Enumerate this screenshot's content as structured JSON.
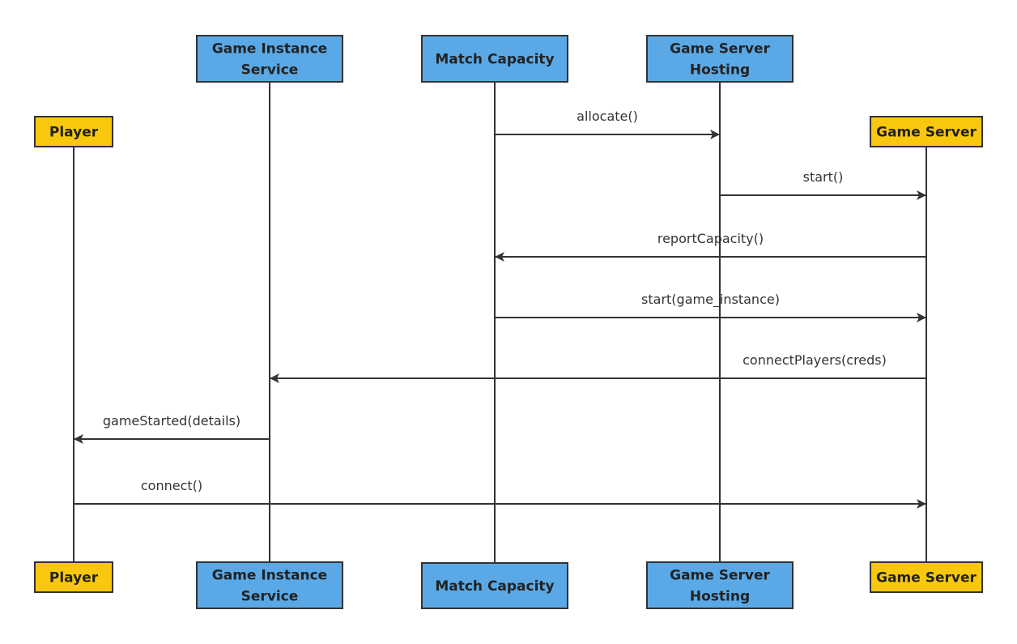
{
  "colors": {
    "service": "#5aa9e6",
    "actor": "#f9c80e",
    "line": "#333333"
  },
  "participants": [
    {
      "id": "player",
      "lines": [
        "Player"
      ],
      "kind": "actor"
    },
    {
      "id": "gis",
      "lines": [
        "Game Instance",
        "Service"
      ],
      "kind": "service"
    },
    {
      "id": "mc",
      "lines": [
        "Match Capacity"
      ],
      "kind": "service"
    },
    {
      "id": "gsh",
      "lines": [
        "Game Server",
        "Hosting"
      ],
      "kind": "service"
    },
    {
      "id": "gs",
      "lines": [
        "Game Server"
      ],
      "kind": "actor"
    }
  ],
  "messages": [
    {
      "from": "mc",
      "to": "gsh",
      "label": "allocate()"
    },
    {
      "from": "gsh",
      "to": "gs",
      "label": "start()"
    },
    {
      "from": "gs",
      "to": "mc",
      "label": "reportCapacity()"
    },
    {
      "from": "mc",
      "to": "gs",
      "label": "start(game_instance)"
    },
    {
      "from": "gs",
      "to": "gis",
      "label": "connectPlayers(creds)"
    },
    {
      "from": "gis",
      "to": "player",
      "label": "gameStarted(details)"
    },
    {
      "from": "player",
      "to": "gs",
      "label": "connect()"
    }
  ]
}
